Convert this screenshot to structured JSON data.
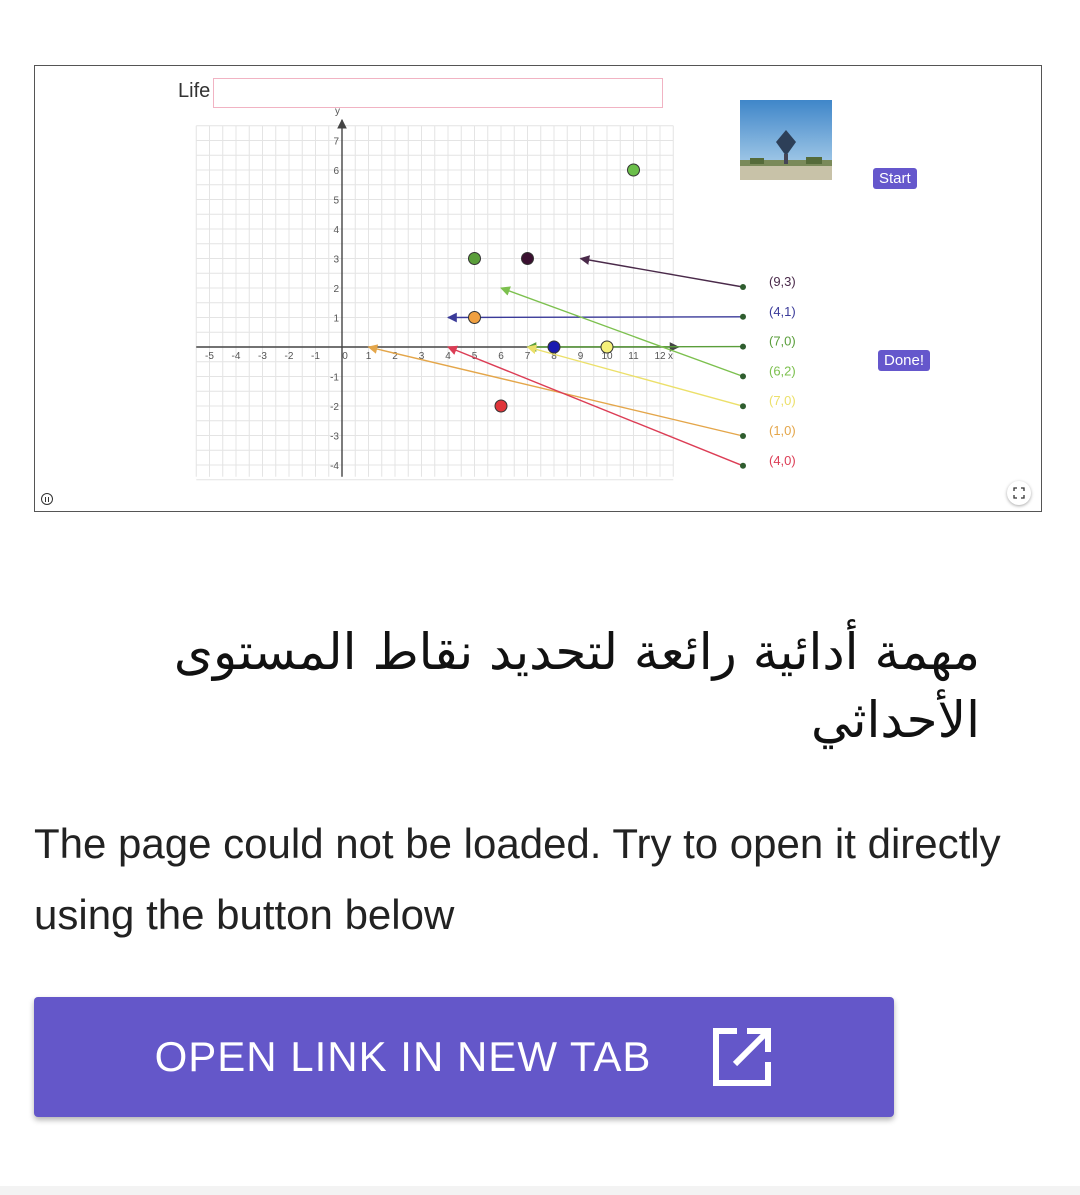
{
  "applet": {
    "life_label": "Life",
    "life_input_value": "",
    "start_label": "Start",
    "done_label": "Done!",
    "graph": {
      "x_range": [
        -5,
        12
      ],
      "y_range": [
        -4,
        7
      ],
      "x_tick_labels": [
        "-5",
        "-4",
        "-3",
        "-2",
        "-1",
        "0",
        "1",
        "2",
        "3",
        "4",
        "5",
        "6",
        "7",
        "8",
        "9",
        "10",
        "11",
        "12"
      ],
      "y_tick_labels": [
        "-4",
        "-3",
        "-2",
        "-1",
        "1",
        "2",
        "3",
        "4",
        "5",
        "6",
        "7"
      ],
      "x_axis_name": "x",
      "y_axis_name": "y",
      "points": [
        {
          "x": 11,
          "y": 6,
          "color": "#6bbf4a"
        },
        {
          "x": 5,
          "y": 3,
          "color": "#5a9e3a"
        },
        {
          "x": 7,
          "y": 3,
          "color": "#3a1030"
        },
        {
          "x": 5,
          "y": 1,
          "color": "#f0a040"
        },
        {
          "x": 8,
          "y": 0,
          "color": "#1a1ab0"
        },
        {
          "x": 10,
          "y": 0,
          "color": "#f5f07a"
        },
        {
          "x": 6,
          "y": -2,
          "color": "#e0353a"
        }
      ],
      "labels": [
        {
          "text": "(9,3)",
          "color": "#4a2a4a",
          "arrow_to": [
            9,
            3
          ]
        },
        {
          "text": "(4,1)",
          "color": "#3a3a99",
          "arrow_to": [
            4,
            1
          ]
        },
        {
          "text": "(7,0)",
          "color": "#5a9e3a",
          "arrow_to": [
            7,
            0
          ]
        },
        {
          "text": "(6,2)",
          "color": "#7cc04e",
          "arrow_to": [
            6,
            2
          ]
        },
        {
          "text": "(7,0)",
          "color": "#ece06a",
          "arrow_to": [
            7,
            0
          ]
        },
        {
          "text": "(1,0)",
          "color": "#e4a64a",
          "arrow_to": [
            1,
            0
          ]
        },
        {
          "text": "(4,0)",
          "color": "#dc3d55",
          "arrow_to": [
            4,
            0
          ]
        }
      ]
    }
  },
  "content": {
    "title_ar": "مهمة أدائية رائعة لتحديد نقاط المستوى الأحداثي",
    "message": "The page could not be loaded. Try to open it directly using the button below",
    "open_button_label": "OPEN LINK IN NEW TAB"
  }
}
